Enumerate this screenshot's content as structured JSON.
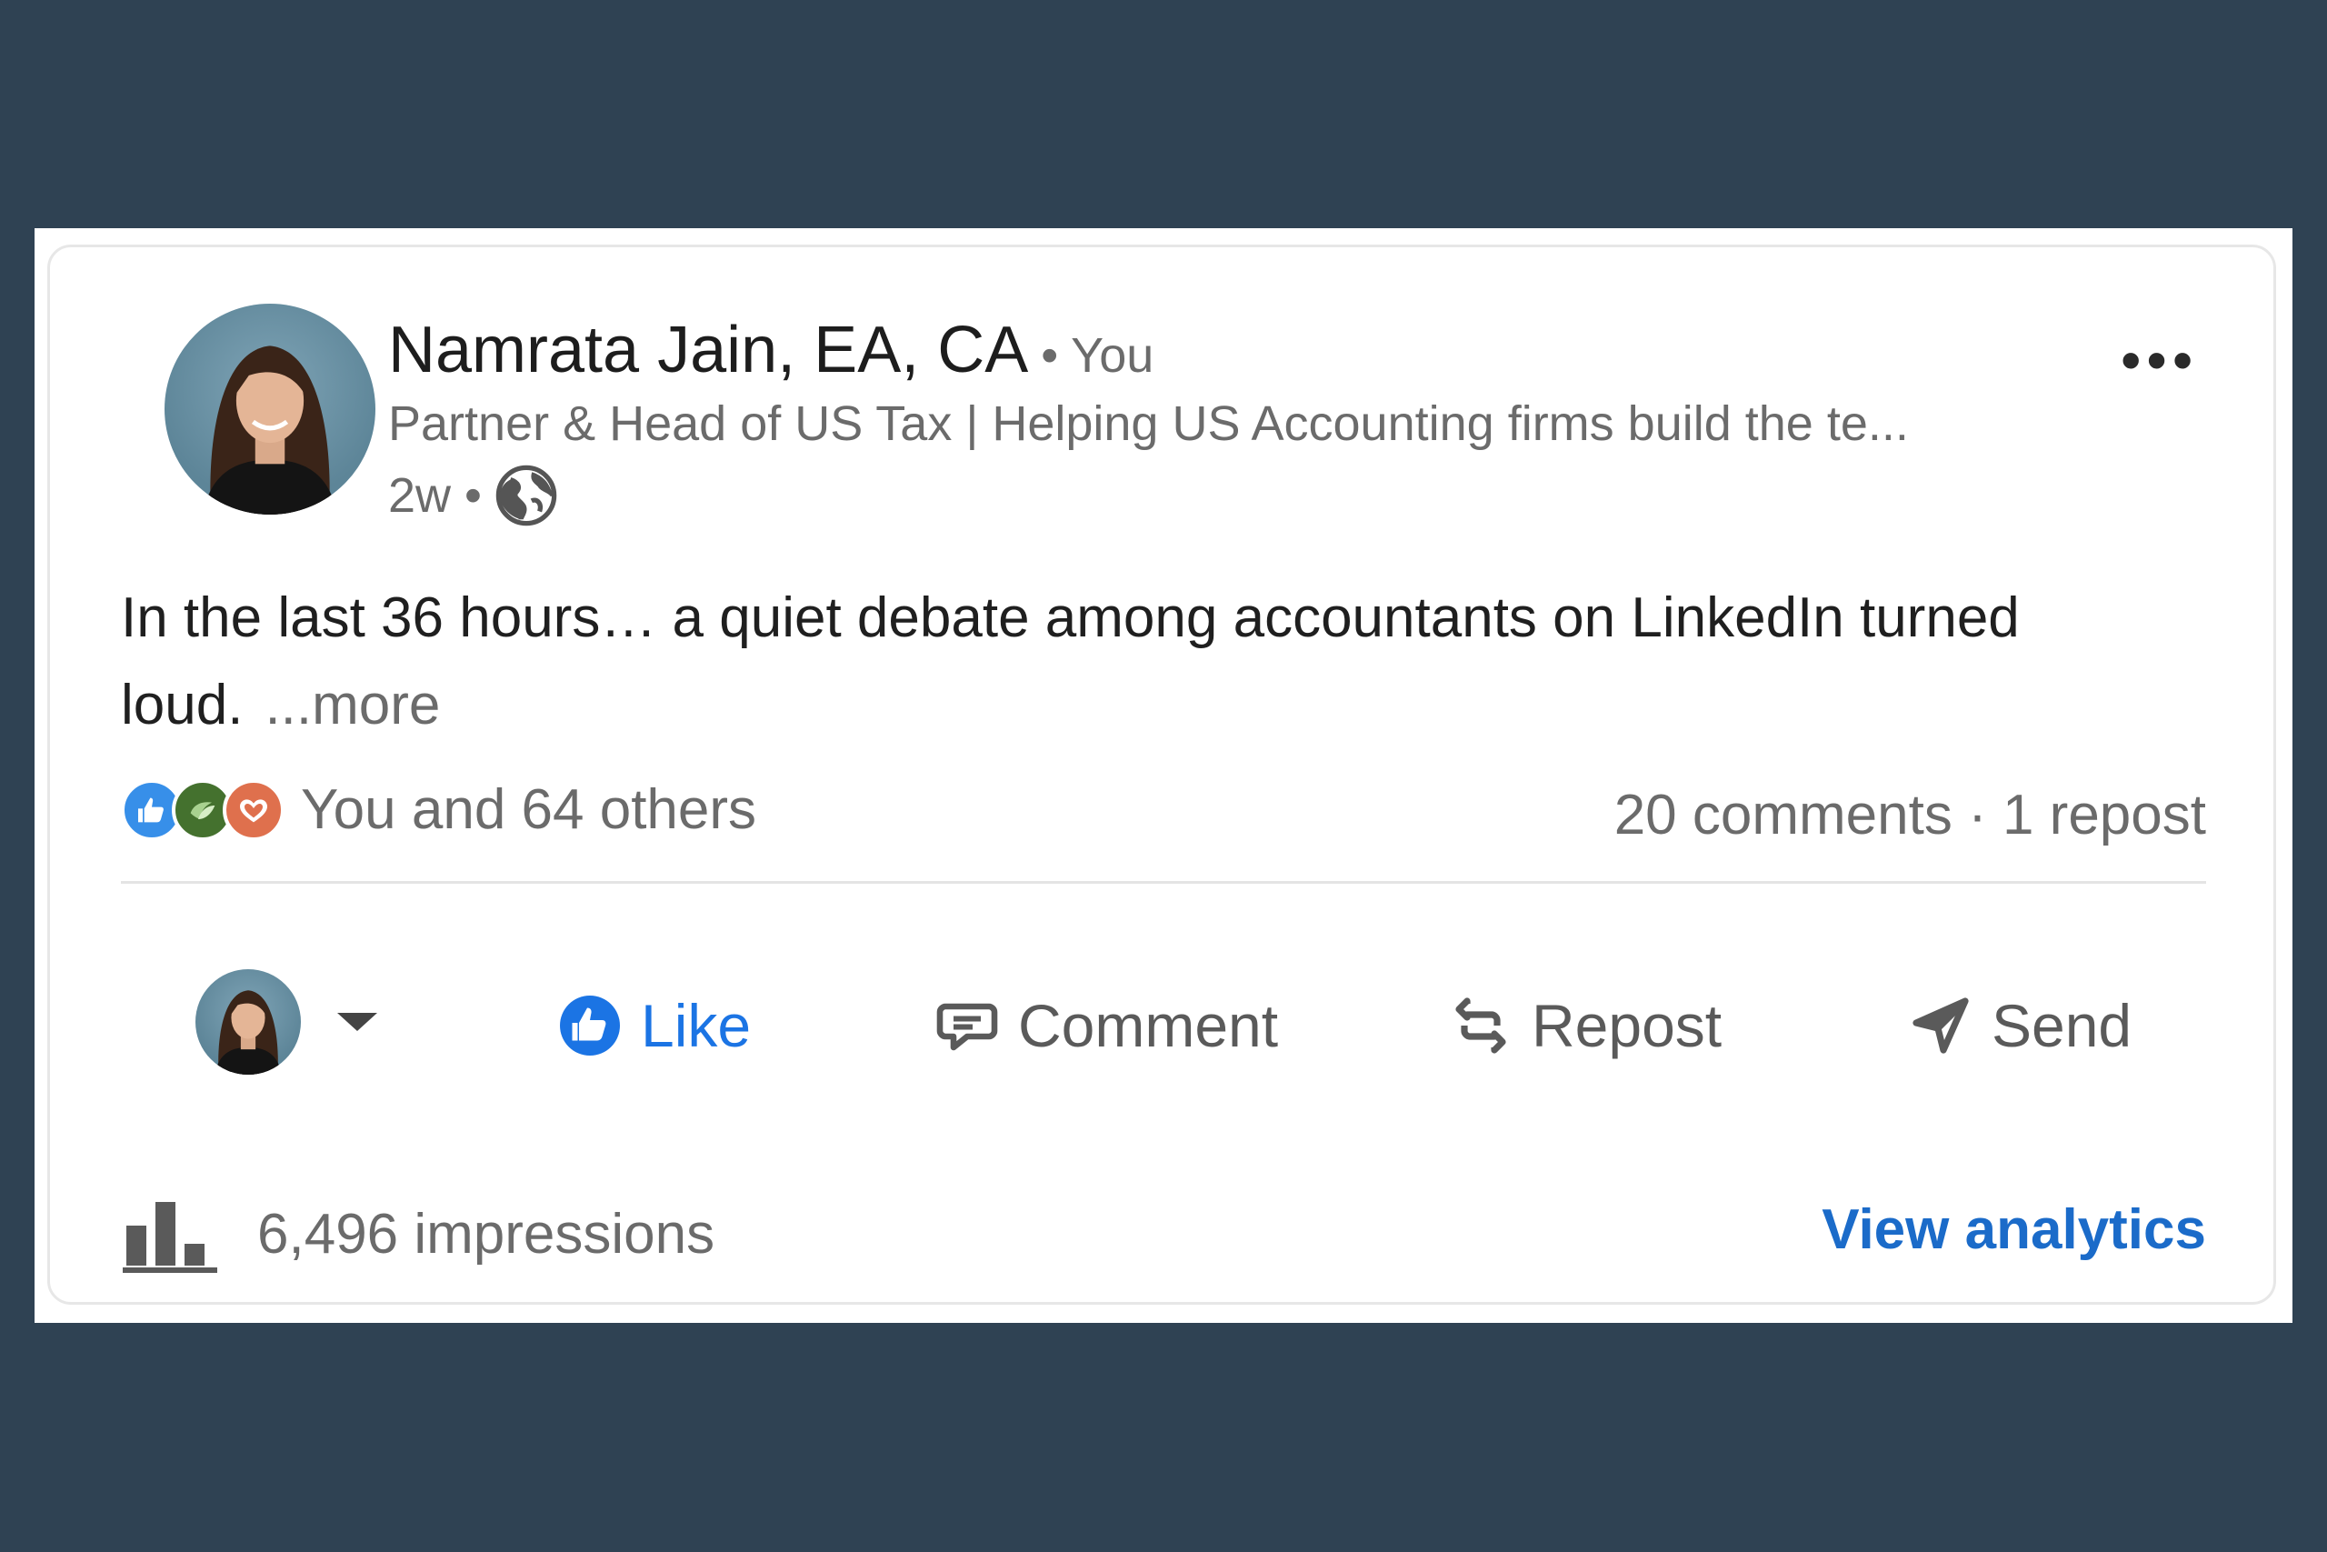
{
  "post": {
    "author_name": "Namrata Jain, EA, CA",
    "author_relation": "• You",
    "headline": "Partner & Head of US Tax | Helping US Accounting firms build the te...",
    "age": "2w •",
    "visibility_icon": "globe-icon",
    "overflow_label": "•••",
    "text": "In the last 36 hours… a quiet debate among accountants on LinkedIn turned loud.",
    "more_label": "...more"
  },
  "social": {
    "reactions_icons": [
      "like-icon",
      "support-icon",
      "love-icon"
    ],
    "reaction_summary": "You and 64 others",
    "comments": "20 comments",
    "separator": "·",
    "reposts": "1 repost"
  },
  "actions": {
    "like": "Like",
    "comment": "Comment",
    "repost": "Repost",
    "send": "Send"
  },
  "analytics": {
    "impressions": "6,496 impressions",
    "view_link": "View analytics"
  },
  "colors": {
    "background": "#2f4253",
    "link_blue": "#1b6bc9",
    "like_blue": "#1b74e4",
    "muted_text": "#6b6b6b"
  }
}
